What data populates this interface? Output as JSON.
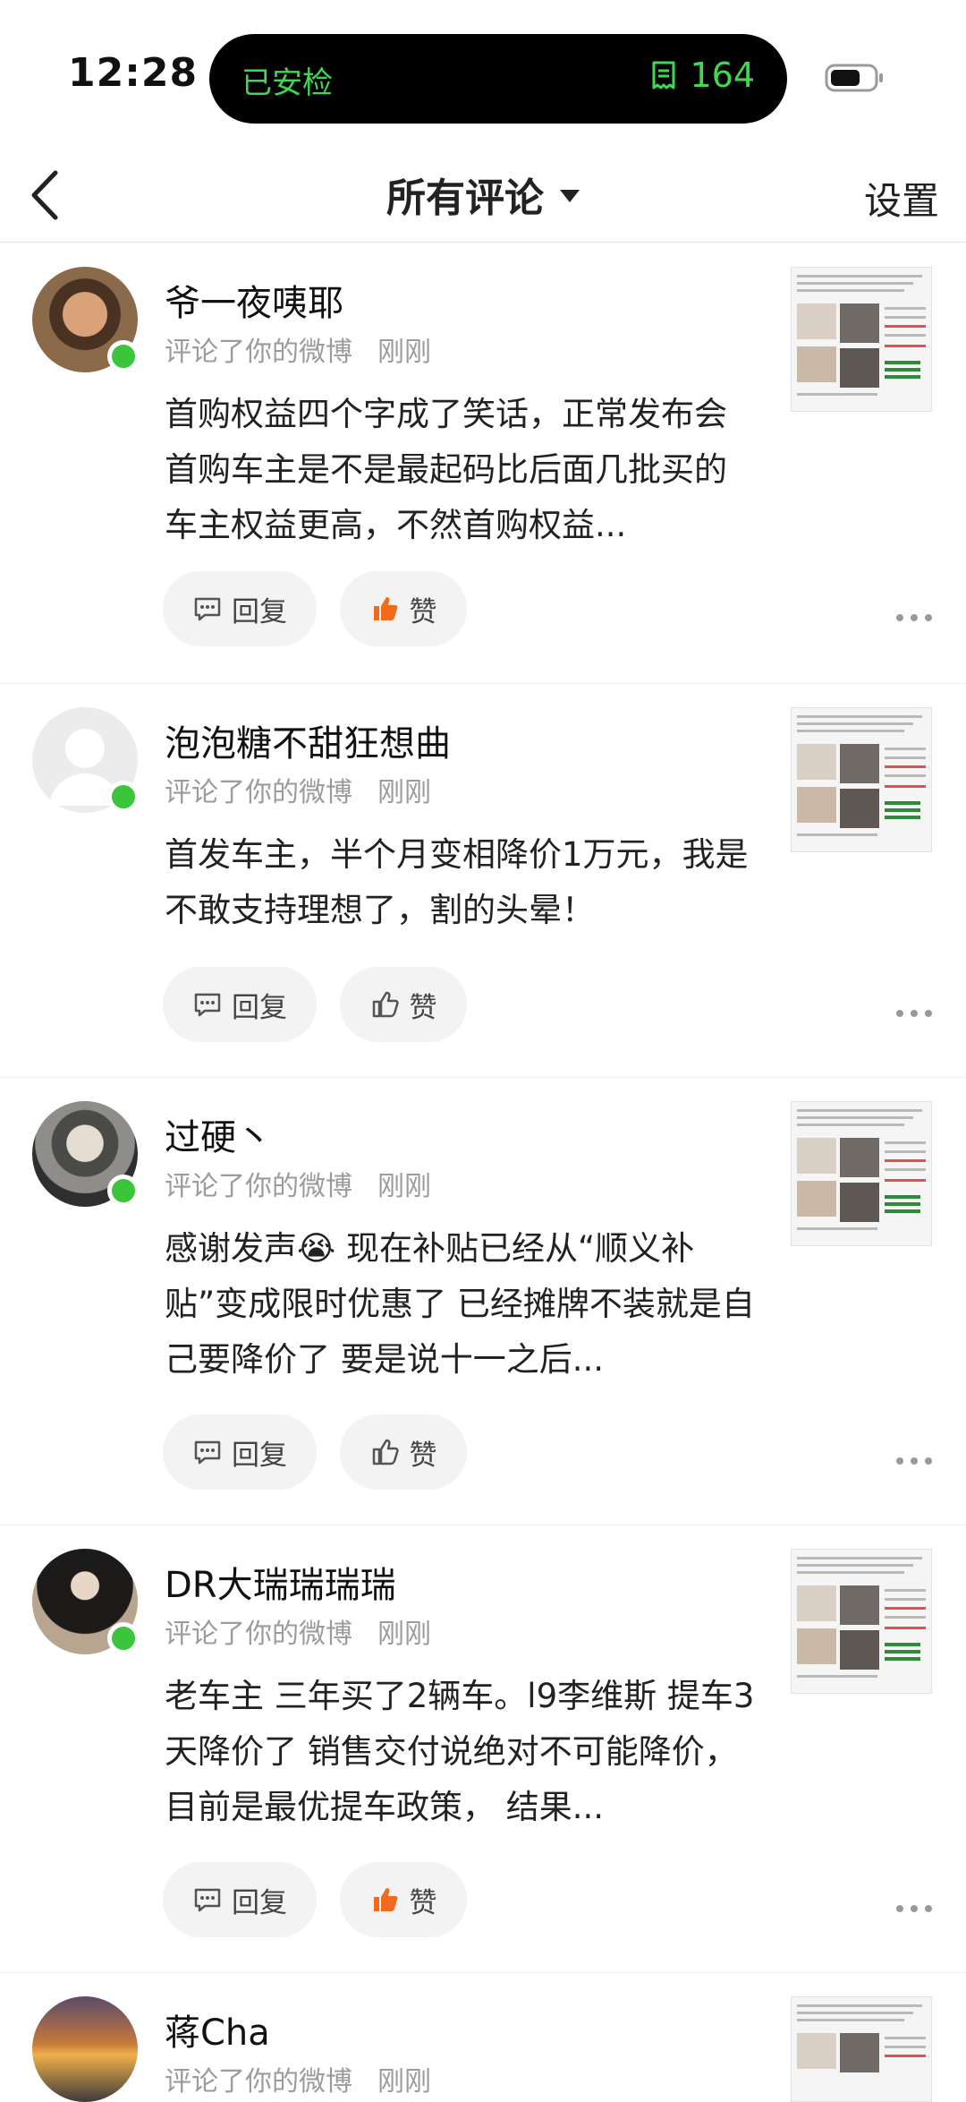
{
  "status": {
    "time": "12:28",
    "island_left": "已安检",
    "island_count": "164"
  },
  "nav": {
    "title": "所有评论",
    "settings": "设置"
  },
  "comments": [
    {
      "name": "爷一夜咦耶",
      "action": "评论了你的微博",
      "time": "刚刚",
      "text": "首购权益四个字成了笑话，正常发布会首购车主是不是最起码比后面几批买的车主权益更高，不然首购权益...",
      "reply": "回复",
      "like": "赞",
      "liked": true
    },
    {
      "name": "泡泡糖不甜狂想曲",
      "action": "评论了你的微博",
      "time": "刚刚",
      "text": "首发车主，半个月变相降价1万元，我是不敢支持理想了，割的头晕！",
      "reply": "回复",
      "like": "赞",
      "liked": false
    },
    {
      "name": "过硬丶",
      "action": "评论了你的微博",
      "time": "刚刚",
      "text": "感谢发声😭 现在补贴已经从“顺义补贴”变成限时优惠了 已经摊牌不装就是自己要降价了 要是说十一之后...",
      "reply": "回复",
      "like": "赞",
      "liked": false
    },
    {
      "name": "DR大瑞瑞瑞瑞",
      "action": "评论了你的微博",
      "time": "刚刚",
      "text": "老车主 三年买了2辆车。l9李维斯 提车3天降价了 销售交付说绝对不可能降价，目前是最优提车政策， 结果...",
      "reply": "回复",
      "like": "赞",
      "liked": true
    },
    {
      "name": "蒋Cha",
      "action": "评论了你的微博",
      "time": "刚刚"
    }
  ],
  "colors": {
    "accent_green": "#3fd84f",
    "online_dot": "#3ac53a",
    "like_orange": "#f26b1d"
  }
}
